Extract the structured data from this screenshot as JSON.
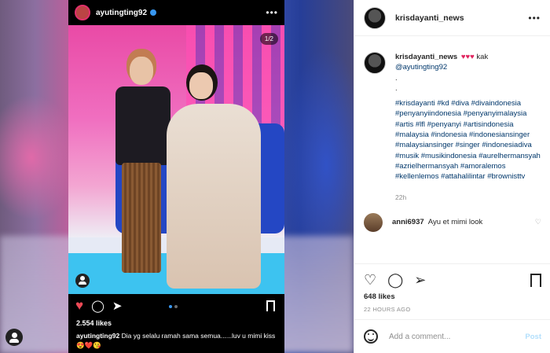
{
  "colors": {
    "accent": "#3897f0",
    "like_red": "#ed4956",
    "link": "#00376b",
    "muted": "#8e8e8e"
  },
  "embedded_post": {
    "username": "ayutingting92",
    "verified": true,
    "photo_counter": "1/2",
    "likes": "2.554 likes",
    "caption_user": "ayutingting92",
    "caption_text": "Dia yg selalu ramah sama semua......luv u mimi  kiss 😍❤️😘",
    "icons": [
      "heart-icon",
      "comment-icon",
      "share-icon",
      "bookmark-icon",
      "user-tag-icon"
    ]
  },
  "panel": {
    "username": "krisdayanti_news",
    "caption_user": "krisdayanti_news",
    "caption_hearts": "♥♥♥",
    "caption_prefix": "kak",
    "caption_mention": "@ayutingting92",
    "caption_dots": ".\n.",
    "hashtags": "#krisdayanti #kd #diva #divaindonesia #penyanyiindonesia #penyanyimalaysia #artis #lfl #penyanyi #artisindonesia #malaysia #indonesia #indonesiansinger #malaysiansinger #singer #indonesiadiva #musik #musikindonesia #aurelhermansyah #azriel­hermansyah #amoralemos #kellenlemos #attahalilintar #brownisttv",
    "time": "22h",
    "comment_user": "anni6937",
    "comment_text": "Ayu et mimi look",
    "likes": "648 likes",
    "date": "22 HOURS AGO",
    "add_comment_placeholder": "Add a comment...",
    "post_label": "Post"
  }
}
